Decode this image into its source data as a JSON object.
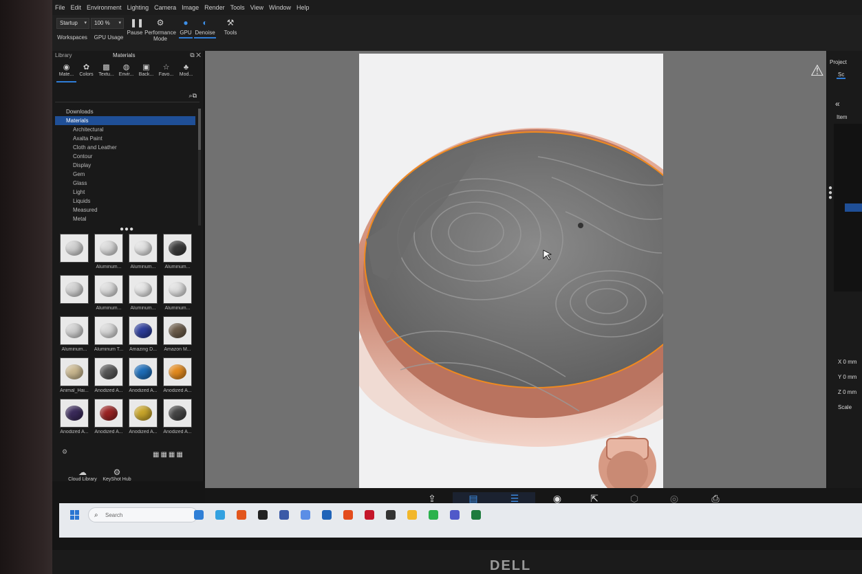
{
  "menu": [
    "File",
    "Edit",
    "Environment",
    "Lighting",
    "Camera",
    "Image",
    "Render",
    "Tools",
    "View",
    "Window",
    "Help"
  ],
  "ribbon": {
    "startup_value": "Startup",
    "zoom_value": "100 %",
    "workspaces": "Workspaces",
    "gpu_usage": "GPU Usage",
    "pause": "Pause",
    "performance_mode": "Performance Mode",
    "gpu": "GPU",
    "denoise": "Denoise",
    "tools": "Tools"
  },
  "library": {
    "title": "Library",
    "panel_title": "Materials",
    "tabs": [
      {
        "label": "Mate...",
        "icon": "sphere-icon"
      },
      {
        "label": "Colors",
        "icon": "palette-icon"
      },
      {
        "label": "Textu...",
        "icon": "texture-icon"
      },
      {
        "label": "Envir...",
        "icon": "globe-icon"
      },
      {
        "label": "Back...",
        "icon": "image-icon"
      },
      {
        "label": "Favo...",
        "icon": "star-icon"
      },
      {
        "label": "Mod...",
        "icon": "models-icon"
      }
    ],
    "tree": [
      "Downloads",
      "Materials",
      "Architectural",
      "Axalta Paint",
      "Cloth and Leather",
      "Contour",
      "Display",
      "Gem",
      "Glass",
      "Light",
      "Liquids",
      "Measured",
      "Metal"
    ],
    "materials": [
      {
        "label": "",
        "color": "#cfcfcf"
      },
      {
        "label": "Aluminum...",
        "color": "#d9d9d9"
      },
      {
        "label": "Aluminum...",
        "color": "#e1e1e1"
      },
      {
        "label": "Aluminum...",
        "color": "#3a3a3a"
      },
      {
        "label": "",
        "color": "#d0d0d0"
      },
      {
        "label": "Aluminum...",
        "color": "#dcdcdc"
      },
      {
        "label": "Aluminum...",
        "color": "#e4e4e4"
      },
      {
        "label": "Aluminum...",
        "color": "#e0e0e0"
      },
      {
        "label": "Aluminum...",
        "color": "#cfcfcf"
      },
      {
        "label": "Aluminum T...",
        "color": "#d8d8d8"
      },
      {
        "label": "Amazing D...",
        "color": "#2d3d9a"
      },
      {
        "label": "Amazon M...",
        "color": "#6a5a48"
      },
      {
        "label": "Animal_Hai...",
        "color": "#c9b78f"
      },
      {
        "label": "Anodized A...",
        "color": "#555555"
      },
      {
        "label": "Anodized A...",
        "color": "#1d6db8"
      },
      {
        "label": "Anodized A...",
        "color": "#e38a1e"
      },
      {
        "label": "Anodized A...",
        "color": "#3a2a5a"
      },
      {
        "label": "Anodized A...",
        "color": "#9a2222"
      },
      {
        "label": "Anodized A...",
        "color": "#c8a52a"
      },
      {
        "label": "Anodized A...",
        "color": "#444444"
      }
    ],
    "cloud_library": "Cloud Library",
    "keyshot_hub": "KeyShot Hub"
  },
  "right_panel": {
    "project": "Project",
    "scene_tab": "Sc",
    "items": "Item",
    "coords": [
      "X 0 mm",
      "Y 0 mm",
      "Z 0 mm"
    ],
    "scale": "Scale"
  },
  "bottom_toolbar": [
    {
      "label": "Import",
      "icon": "import-icon",
      "state": "normal"
    },
    {
      "label": "Library",
      "icon": "library-icon",
      "state": "selected"
    },
    {
      "label": "Project",
      "icon": "project-icon",
      "state": "selected"
    },
    {
      "label": "Animation",
      "icon": "animation-icon",
      "state": "normal"
    },
    {
      "label": "Export Mode",
      "icon": "export-icon",
      "state": "normal"
    },
    {
      "label": "KeyShotXR",
      "icon": "keyshotxr-icon",
      "state": "dim"
    },
    {
      "label": "VR",
      "icon": "vr-icon",
      "state": "dim"
    },
    {
      "label": "Render",
      "icon": "render-icon",
      "state": "normal"
    }
  ],
  "taskbar": {
    "search_placeholder": "Search",
    "apps": [
      "#2f7fd6",
      "#33a1e0",
      "#e2561d",
      "#222222",
      "#3b5aa7",
      "#5b8ee6",
      "#1f63b8",
      "#e34b1b",
      "#c4162a",
      "#333333",
      "#f2b72a",
      "#2bb24c",
      "#5059c9",
      "#1e7b3d"
    ]
  },
  "brand": "DELL",
  "colors": {
    "accent": "#2f7dd8",
    "selection": "#1f4f97",
    "rose_gold": "#d99a84"
  }
}
